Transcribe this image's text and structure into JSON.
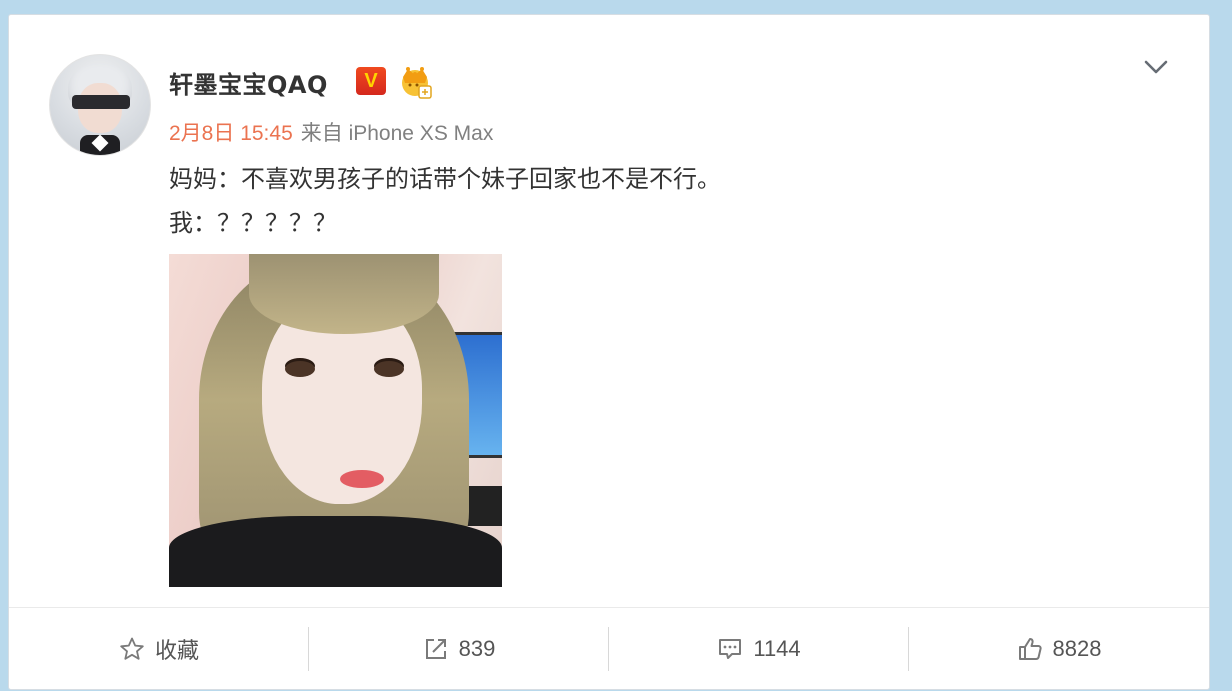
{
  "post": {
    "user_name": "轩墨宝宝QAQ",
    "verified_badge": "V",
    "date": "2月8日 15:45",
    "source": "来自 iPhone XS Max",
    "lines": [
      "妈妈：不喜欢男孩子的话带个妹子回家也不是不行。",
      "我：？？？？？"
    ],
    "menu_icon": "chevron-down-icon",
    "crown_icon": "member-crown-icon"
  },
  "actions": {
    "favorite": {
      "label": "收藏",
      "icon": "star-icon"
    },
    "repost": {
      "count": "839",
      "icon": "share-icon"
    },
    "comment": {
      "count": "1144",
      "icon": "comment-icon"
    },
    "like": {
      "count": "8828",
      "icon": "thumbs-up-icon"
    }
  },
  "colors": {
    "time": "#eb7350",
    "vip_badge": "#e23a1f",
    "page_bg": "#b9d9ec"
  }
}
